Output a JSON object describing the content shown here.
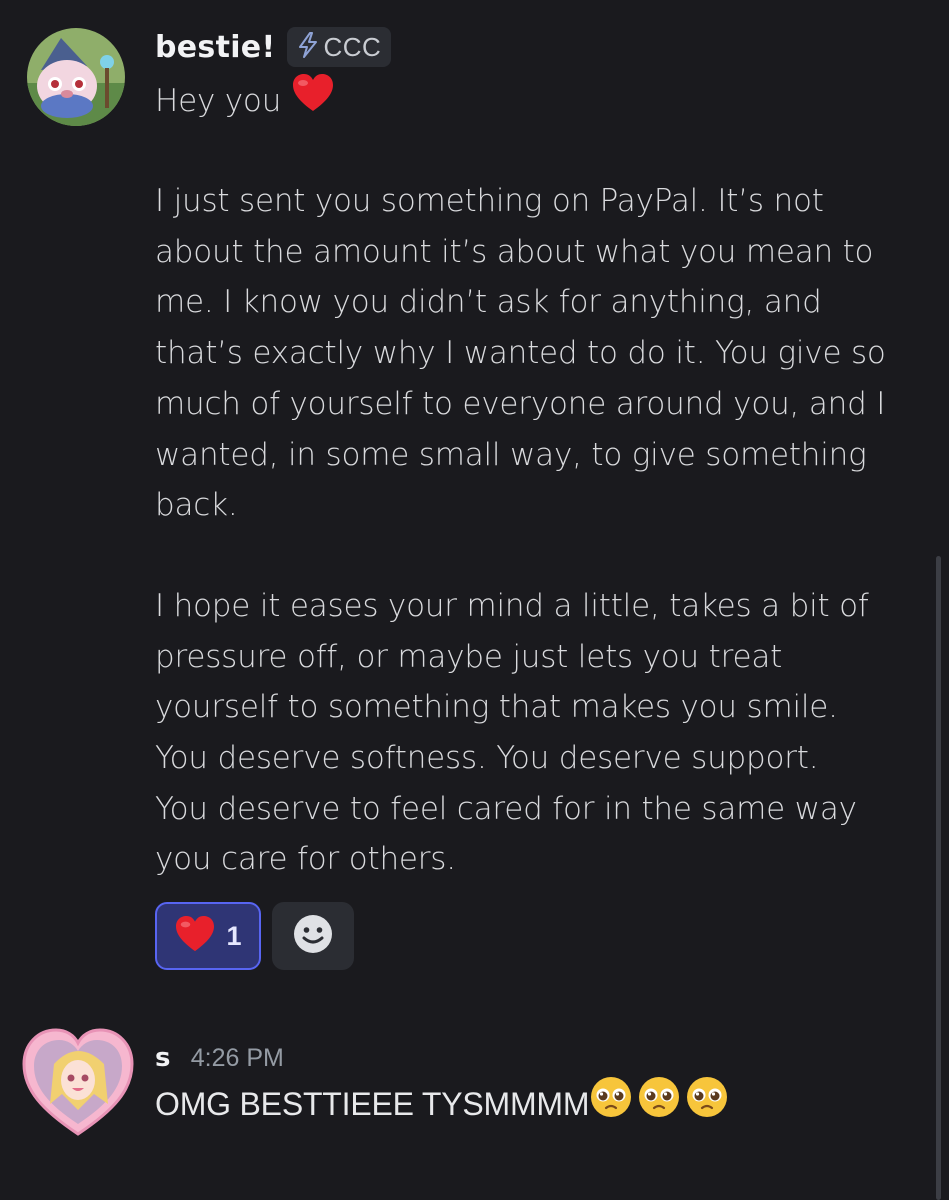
{
  "messages": [
    {
      "author": "bestie!",
      "role_tag": "CCC",
      "greeting": "Hey you",
      "paragraph_1": "I just sent you something on PayPal. It’s not\nabout the amount it’s about what you mean to\nme. I know you didn’t ask for anything, and\nthat’s exactly why I wanted to do it. You give so\nmuch of yourself to everyone around you, and I\nwanted, in some small way, to give something\nback.",
      "paragraph_2": "I hope it eases your mind a little, takes a bit of\npressure off, or maybe just lets you treat\nyourself to something that makes you smile.\nYou deserve softness. You deserve support.\nYou deserve to feel cared for in the same way\nyou care for others.",
      "reaction": {
        "emoji": "heart",
        "count": "1"
      }
    },
    {
      "author": "s",
      "timestamp": "4:26 PM",
      "text": "OMG BESTTIEEE TYSMMMM"
    }
  ],
  "colors": {
    "background": "#1a1a1e",
    "accent": "#5865f2",
    "heart": "#e8202b"
  }
}
